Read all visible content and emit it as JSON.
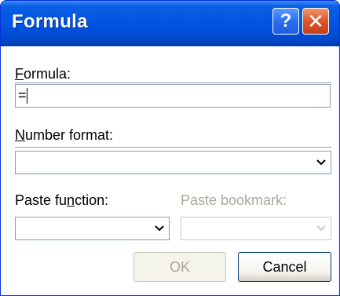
{
  "window": {
    "title": "Formula",
    "help_glyph": "?",
    "close_glyph": "✕"
  },
  "formula": {
    "label_first": "F",
    "label_rest": "ormula:",
    "value": "="
  },
  "number_format": {
    "label_first": "N",
    "label_rest": "umber format:",
    "value": ""
  },
  "paste_function": {
    "label_pre": "Paste fu",
    "label_accel": "n",
    "label_post": "ction:",
    "value": ""
  },
  "paste_bookmark": {
    "label": "Paste bookmark:",
    "value": ""
  },
  "buttons": {
    "ok": "OK",
    "cancel": "Cancel"
  },
  "colors": {
    "titlebar": "#0054e3",
    "close": "#e0552a",
    "disabled_text": "#aca899"
  },
  "icons": {
    "help": "help-icon",
    "close": "close-icon",
    "dropdown": "chevron-down-icon"
  }
}
